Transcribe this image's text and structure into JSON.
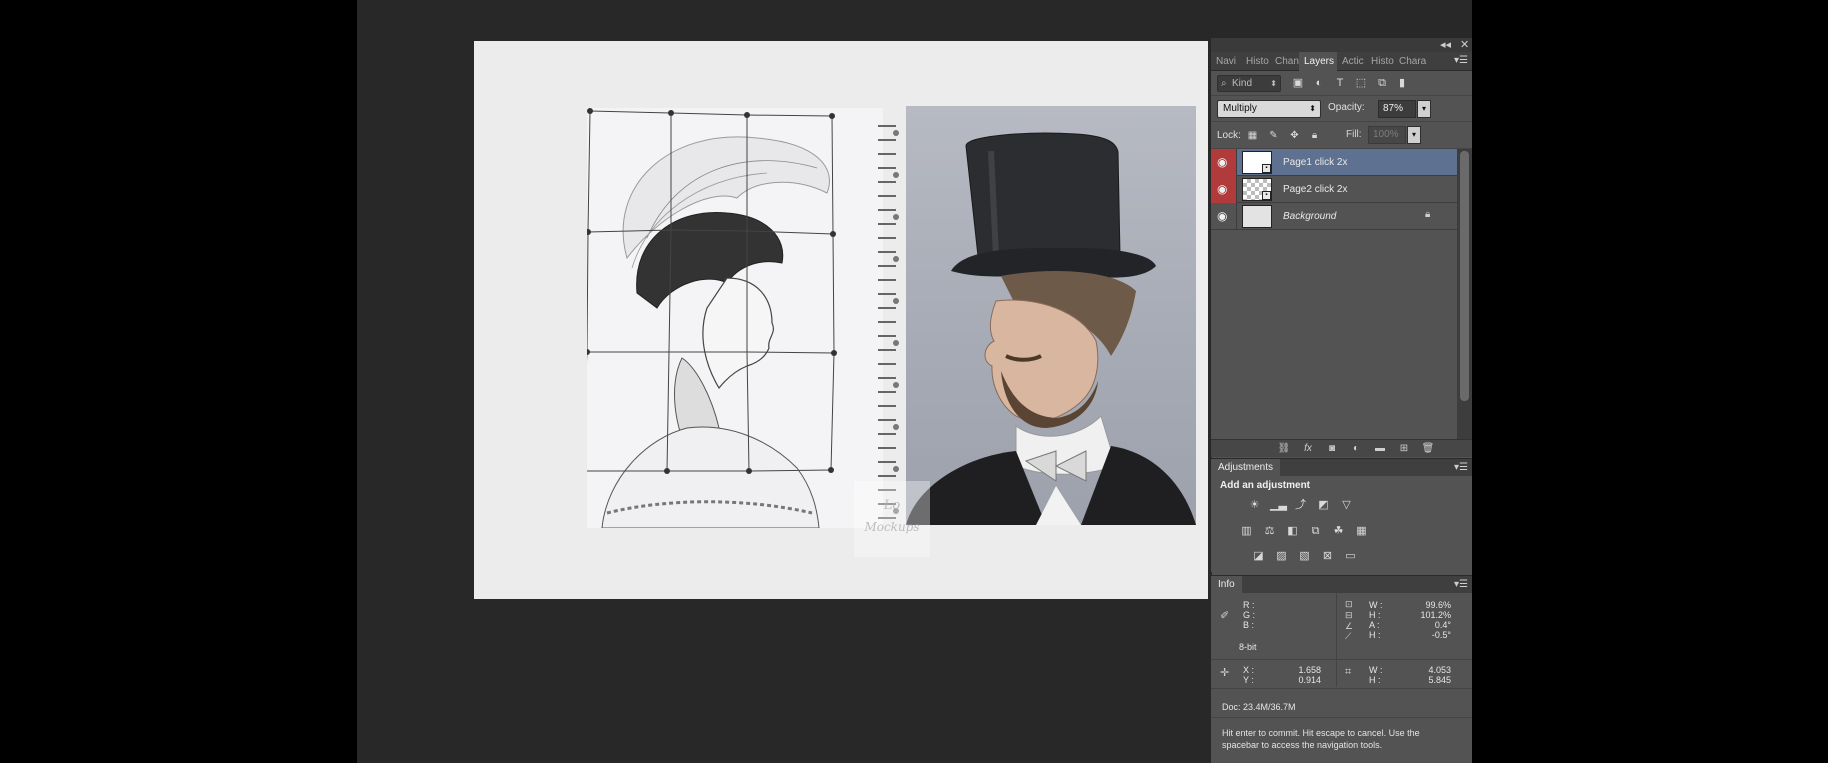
{
  "panel_controls": {
    "collapse": "◂◂",
    "close": "✕"
  },
  "tabs": [
    {
      "label": "Navi",
      "active": false
    },
    {
      "label": "Histo",
      "active": false
    },
    {
      "label": "Chan",
      "active": false
    },
    {
      "label": "Layers",
      "active": true
    },
    {
      "label": "Actic",
      "active": false
    },
    {
      "label": "Histo",
      "active": false
    },
    {
      "label": "Chara",
      "active": false
    }
  ],
  "layers_panel": {
    "kind_filter": "Kind",
    "blend_mode": "Multiply",
    "opacity_label": "Opacity:",
    "opacity_value": "87%",
    "lock_label": "Lock:",
    "fill_label": "Fill:",
    "fill_value": "100%",
    "layers": [
      {
        "name": "Page1 click 2x",
        "visible": true,
        "selected": true
      },
      {
        "name": "Page2 click 2x",
        "visible": true,
        "selected": false
      },
      {
        "name": "Background",
        "visible": true,
        "selected": false,
        "locked": true
      }
    ]
  },
  "adjustments": {
    "tab_label": "Adjustments",
    "title": "Add an adjustment"
  },
  "info": {
    "tab_label": "Info",
    "r_label": "R :",
    "g_label": "G :",
    "b_label": "B :",
    "bit_depth": "8-bit",
    "w_label": "W :",
    "h_label": "H :",
    "a_label": "A :",
    "h2_label": "H :",
    "w_value": "99.6%",
    "h_value": "101.2%",
    "a_value": "0.4°",
    "h2_value": "-0.5°",
    "x_label": "X :",
    "y_label": "Y :",
    "x_value": "1.658",
    "y_value": "0.914",
    "w2_label": "W :",
    "h3_label": "H :",
    "w2_value": "4.053",
    "h3_value": "5.845",
    "doc": "Doc: 23.4M/36.7M",
    "hint": "Hit enter to commit. Hit escape to cancel. Use the spacebar to access the navigation tools."
  },
  "colors": {
    "workspace": "#282828",
    "panel": "#535353",
    "selected_layer": "#5e7190",
    "visibility_red": "#b13a3a"
  }
}
